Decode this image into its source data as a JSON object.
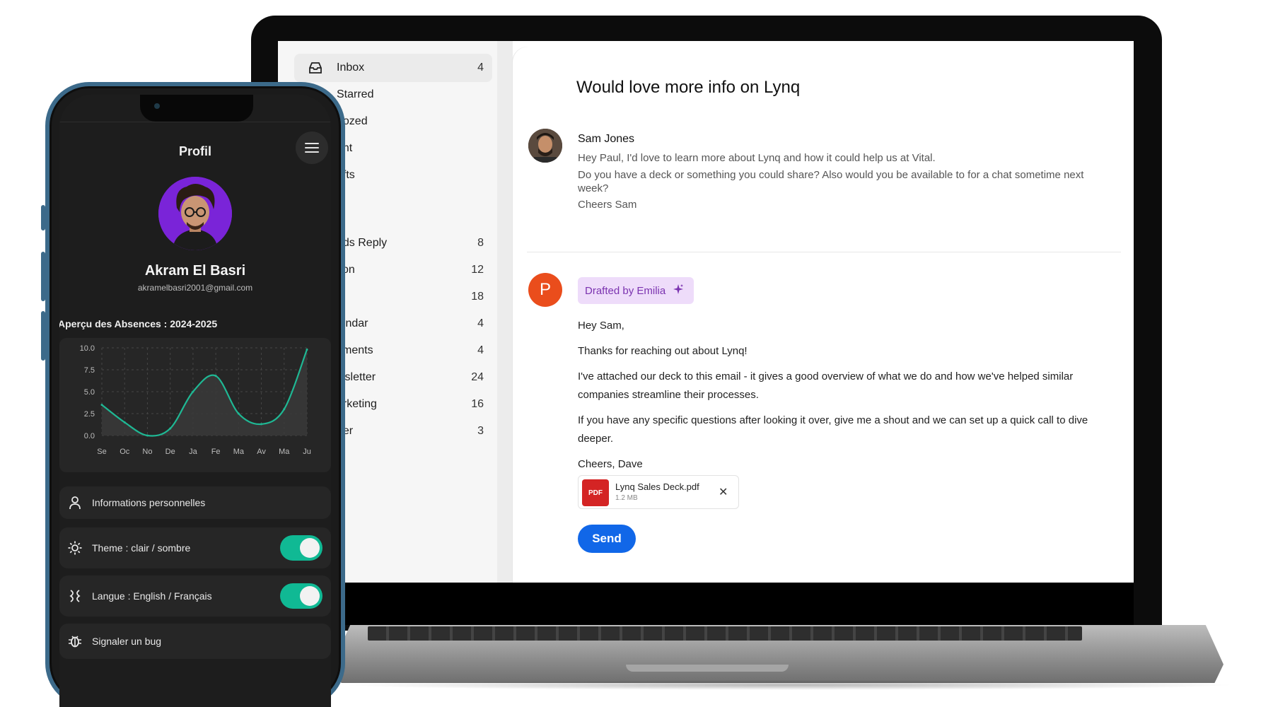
{
  "email": {
    "sidebar": {
      "items": [
        {
          "label": "Inbox",
          "count": "4",
          "icon": "inbox-icon"
        },
        {
          "label": "Starred",
          "count": ""
        },
        {
          "label": "oozed",
          "count": ""
        },
        {
          "label": "ent",
          "count": ""
        },
        {
          "label": "afts",
          "count": ""
        },
        {
          "label": "eds Reply",
          "count": "8"
        },
        {
          "label": "tion",
          "count": "12"
        },
        {
          "label": "",
          "count": "18"
        },
        {
          "label": "lendar",
          "count": "4"
        },
        {
          "label": "yments",
          "count": "4"
        },
        {
          "label": "wsletter",
          "count": "24"
        },
        {
          "label": "arketing",
          "count": "16"
        },
        {
          "label": "her",
          "count": "3"
        }
      ]
    },
    "thread": {
      "subject": "Would love more info on Lynq",
      "incoming": {
        "sender": "Sam Jones",
        "lines": [
          "Hey Paul, I'd love to learn more about Lynq and how it could help us at Vital.",
          "Do you have a deck or something you could share? Also would you be available to for a chat sometime next week?",
          "Cheers Sam"
        ]
      },
      "reply": {
        "avatar_letter": "P",
        "badge": "Drafted by Emilia",
        "lines": [
          "Hey Sam,",
          "Thanks for reaching out about Lynq!",
          "I've attached our deck to this email - it gives a good overview of what we do and how we've helped similar companies streamline their processes.",
          "If you have any specific questions after looking it over, give me a shout and we can set up a quick call to dive deeper.",
          "Cheers, Dave"
        ],
        "attachment": {
          "badge": "PDF",
          "name": "Lynq Sales Deck.pdf",
          "size": "1.2 MB"
        },
        "send_label": "Send"
      }
    }
  },
  "phone": {
    "title": "Profil",
    "name": "Akram El Basri",
    "email": "akramelbasri2001@gmail.com",
    "absences_label": "Aperçu des Absences :",
    "absences_year": "2024-2025",
    "menu": [
      {
        "label": "Informations personnelles",
        "icon": "user-icon"
      },
      {
        "label": "Theme : clair / sombre",
        "icon": "sun-icon",
        "toggle": true
      },
      {
        "label": "Langue : English / Français",
        "icon": "language-icon",
        "toggle": true
      },
      {
        "label": "Signaler un bug",
        "icon": "bug-icon"
      }
    ]
  },
  "chart_data": {
    "type": "area",
    "title": "",
    "x": [
      "Se",
      "Oc",
      "No",
      "De",
      "Ja",
      "Fe",
      "Ma",
      "Av",
      "Ma",
      "Ju"
    ],
    "series": [
      {
        "values": [
          3.5,
          1.5,
          0.0,
          0.8,
          5.0,
          6.8,
          2.5,
          1.3,
          3.0,
          9.8
        ]
      }
    ],
    "y_ticks": [
      "0.0",
      "2.5",
      "5.0",
      "7.5",
      "10.0"
    ],
    "ylim": [
      0,
      10
    ],
    "grid": true,
    "colors": {
      "line": "#1fb894",
      "fill": "#3a3a3a"
    }
  }
}
